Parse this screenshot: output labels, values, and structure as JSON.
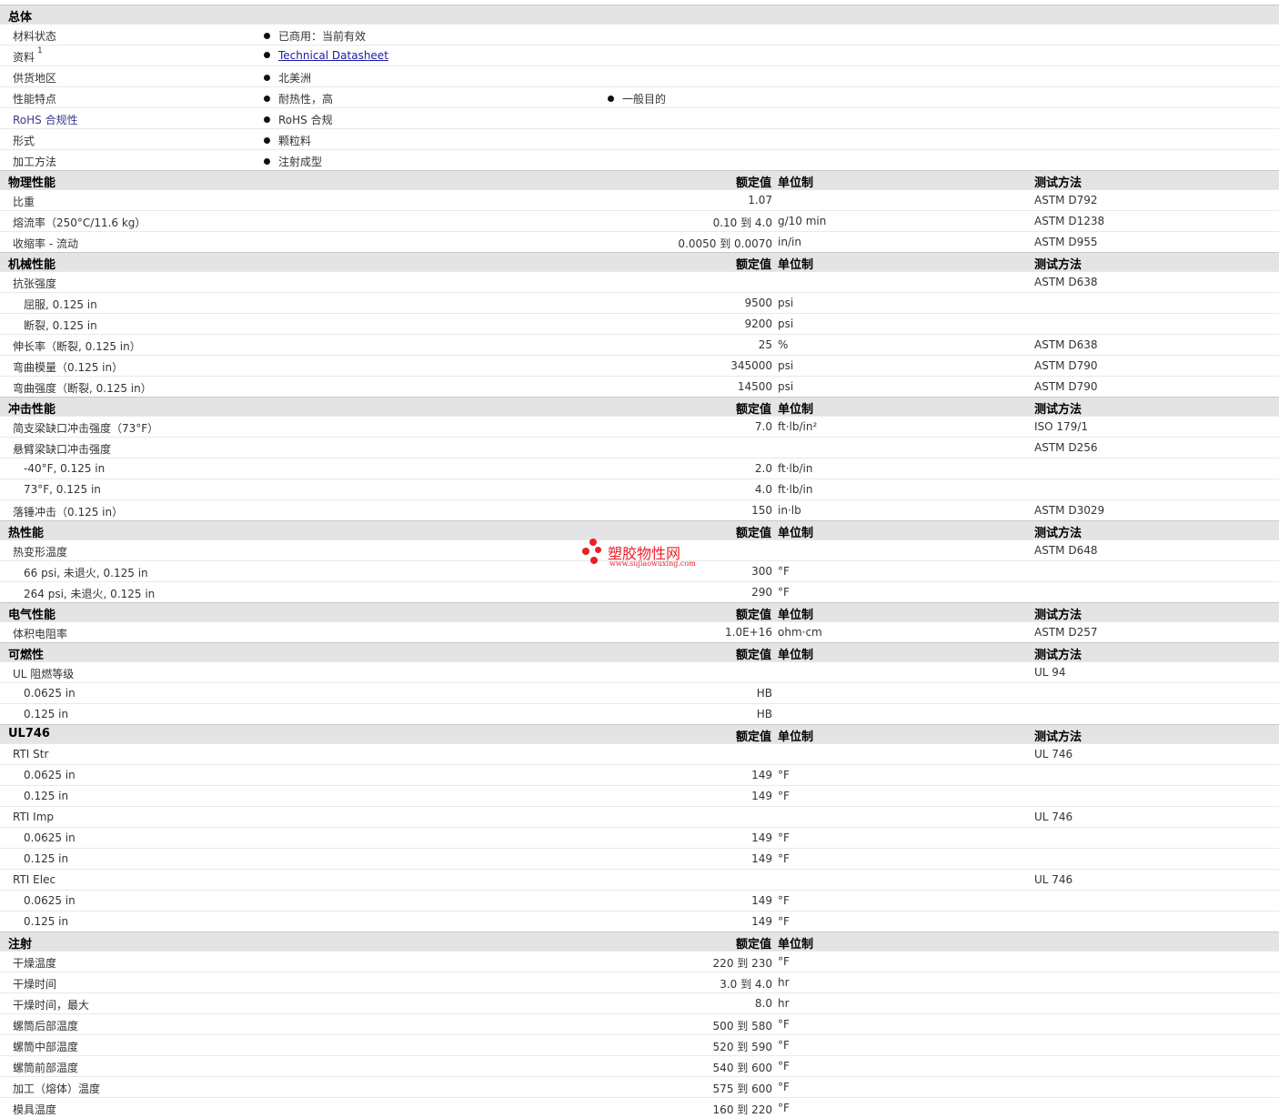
{
  "general": {
    "title": "总体",
    "rows": [
      {
        "label": "材料状态",
        "items": [
          "已商用：当前有效"
        ]
      },
      {
        "label": "资料",
        "sup": "1",
        "link": "Technical Datasheet"
      },
      {
        "label": "供货地区",
        "items": [
          "北美洲"
        ]
      },
      {
        "label": "性能特点",
        "items": [
          "耐热性，高",
          "一般目的"
        ]
      },
      {
        "label": "RoHS 合规性",
        "items": [
          "RoHS 合规"
        ]
      },
      {
        "label": "形式",
        "items": [
          "颗粒料"
        ]
      },
      {
        "label": "加工方法",
        "items": [
          "注射成型"
        ]
      }
    ]
  },
  "headers": {
    "nominal": "额定值",
    "unit": "单位制",
    "test": "测试方法"
  },
  "sections": [
    {
      "title": "物理性能",
      "rows": [
        {
          "label": "比重",
          "value": "1.07",
          "unit": "",
          "test": "ASTM D792"
        },
        {
          "label": "熔流率（250°C/11.6 kg）",
          "value": "0.10 到  4.0",
          "unit": "g/10 min",
          "test": "ASTM D1238"
        },
        {
          "label": "收缩率  - 流动",
          "value": "0.0050 到  0.0070",
          "unit": "in/in",
          "test": "ASTM D955"
        }
      ]
    },
    {
      "title": "机械性能",
      "rows": [
        {
          "label": "抗张强度",
          "value": "",
          "unit": "",
          "test": "ASTM D638"
        },
        {
          "label": "屈服, 0.125 in",
          "sub": true,
          "value": "9500",
          "unit": "psi",
          "test": ""
        },
        {
          "label": "断裂, 0.125 in",
          "sub": true,
          "value": "9200",
          "unit": "psi",
          "test": ""
        },
        {
          "label": "伸长率（断裂, 0.125 in）",
          "value": "25",
          "unit": "%",
          "test": "ASTM D638"
        },
        {
          "label": "弯曲模量（0.125 in）",
          "value": "345000",
          "unit": "psi",
          "test": "ASTM D790"
        },
        {
          "label": "弯曲强度（断裂, 0.125 in）",
          "value": "14500",
          "unit": "psi",
          "test": "ASTM D790"
        }
      ]
    },
    {
      "title": "冲击性能",
      "rows": [
        {
          "label": "简支梁缺口冲击强度（73°F）",
          "value": "7.0",
          "unit": "ft·lb/in²",
          "test": "ISO 179/1"
        },
        {
          "label": "悬臂梁缺口冲击强度",
          "value": "",
          "unit": "",
          "test": "ASTM D256"
        },
        {
          "label": "-40°F, 0.125 in",
          "sub": true,
          "value": "2.0",
          "unit": "ft·lb/in",
          "test": ""
        },
        {
          "label": "73°F, 0.125 in",
          "sub": true,
          "value": "4.0",
          "unit": "ft·lb/in",
          "test": ""
        },
        {
          "label": "落锤冲击（0.125 in）",
          "value": "150",
          "unit": "in·lb",
          "test": "ASTM D3029"
        }
      ]
    },
    {
      "title": "热性能",
      "rows": [
        {
          "label": "热变形温度",
          "value": "",
          "unit": "",
          "test": "ASTM D648"
        },
        {
          "label": "66 psi, 未退火, 0.125 in",
          "sub": true,
          "value": "300",
          "unit": "°F",
          "test": ""
        },
        {
          "label": "264 psi, 未退火, 0.125 in",
          "sub": true,
          "value": "290",
          "unit": "°F",
          "test": ""
        }
      ]
    },
    {
      "title": "电气性能",
      "rows": [
        {
          "label": "体积电阻率",
          "value": "1.0E+16",
          "unit": "ohm·cm",
          "test": "ASTM D257"
        }
      ]
    },
    {
      "title": "可燃性",
      "rows": [
        {
          "label": "UL 阻燃等级",
          "value": "",
          "unit": "",
          "test": "UL 94"
        },
        {
          "label": "0.0625 in",
          "sub": true,
          "value": "HB",
          "unit": "",
          "test": ""
        },
        {
          "label": "0.125 in",
          "sub": true,
          "value": "HB",
          "unit": "",
          "test": ""
        }
      ]
    },
    {
      "title": "UL746",
      "rows": [
        {
          "label": "RTI Str",
          "value": "",
          "unit": "",
          "test": "UL 746"
        },
        {
          "label": "0.0625 in",
          "sub": true,
          "value": "149",
          "unit": "°F",
          "test": ""
        },
        {
          "label": "0.125 in",
          "sub": true,
          "value": "149",
          "unit": "°F",
          "test": ""
        },
        {
          "label": "RTI Imp",
          "value": "",
          "unit": "",
          "test": "UL 746"
        },
        {
          "label": "0.0625 in",
          "sub": true,
          "value": "149",
          "unit": "°F",
          "test": ""
        },
        {
          "label": "0.125 in",
          "sub": true,
          "value": "149",
          "unit": "°F",
          "test": ""
        },
        {
          "label": "RTI Elec",
          "value": "",
          "unit": "",
          "test": "UL 746"
        },
        {
          "label": "0.0625 in",
          "sub": true,
          "value": "149",
          "unit": "°F",
          "test": ""
        },
        {
          "label": "0.125 in",
          "sub": true,
          "value": "149",
          "unit": "°F",
          "test": ""
        }
      ]
    },
    {
      "title": "注射",
      "rows": [
        {
          "label": "干燥温度",
          "value": "220 到  230",
          "unit": "°F",
          "test": ""
        },
        {
          "label": "干燥时间",
          "value": "3.0 到  4.0",
          "unit": "hr",
          "test": ""
        },
        {
          "label": "干燥时间，最大",
          "value": "8.0",
          "unit": "hr",
          "test": ""
        },
        {
          "label": "螺筒后部温度",
          "value": "500 到  580",
          "unit": "°F",
          "test": ""
        },
        {
          "label": "螺筒中部温度",
          "value": "520 到  590",
          "unit": "°F",
          "test": ""
        },
        {
          "label": "螺筒前部温度",
          "value": "540 到  600",
          "unit": "°F",
          "test": ""
        },
        {
          "label": "加工（熔体）温度",
          "value": "575 到  600",
          "unit": "°F",
          "test": ""
        },
        {
          "label": "模具温度",
          "value": "160 到  220",
          "unit": "°F",
          "test": ""
        }
      ]
    }
  ],
  "watermark": {
    "title": "塑胶物性网",
    "url": "www.sujiaowuxing.com",
    "color": "#e8202a"
  }
}
